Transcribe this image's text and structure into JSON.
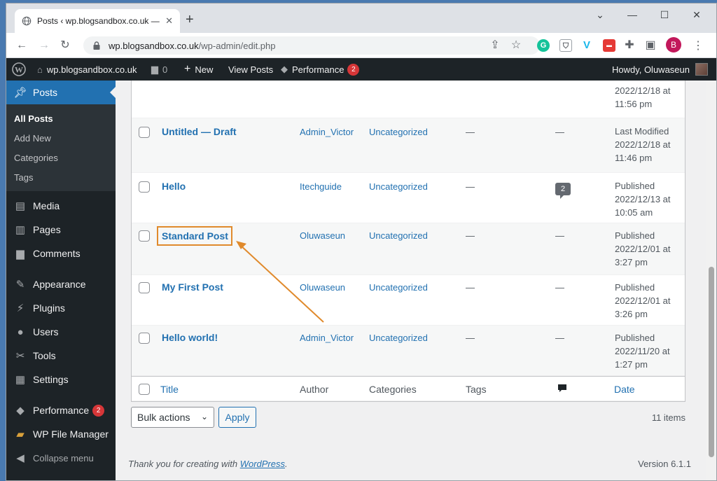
{
  "browser": {
    "tab_title": "Posts ‹ wp.blogsandbox.co.uk —",
    "tab_close": "✕",
    "new_tab": "+",
    "url_domain": "wp.blogsandbox.co.uk",
    "url_path": "/wp-admin/edit.php",
    "profile_initial": "B",
    "ext_grammarly": "G",
    "ext_vimeo": "V"
  },
  "adminbar": {
    "site_name": "wp.blogsandbox.co.uk",
    "comments_count": "0",
    "new_label": "New",
    "view_posts": "View Posts",
    "performance": "Performance",
    "performance_badge": "2",
    "howdy": "Howdy, Oluwaseun"
  },
  "sidebar": {
    "posts": "Posts",
    "sub": [
      "All Posts",
      "Add New",
      "Categories",
      "Tags"
    ],
    "media": "Media",
    "pages": "Pages",
    "comments": "Comments",
    "appearance": "Appearance",
    "plugins": "Plugins",
    "users": "Users",
    "tools": "Tools",
    "settings": "Settings",
    "performance": "Performance",
    "performance_badge": "2",
    "file_manager": "WP File Manager",
    "collapse": "Collapse menu"
  },
  "table": {
    "partial_row": {
      "date_line2": "2022/12/18 at",
      "date_line3": "11:56 pm"
    },
    "rows": [
      {
        "title": "Untitled — Draft",
        "author": "Admin_Victor",
        "category": "Uncategorized",
        "tags": "—",
        "comments": "—",
        "status": "Last Modified",
        "date": "2022/12/18 at",
        "time": "11:46 pm"
      },
      {
        "title": "Hello",
        "author": "Itechguide",
        "category": "Uncategorized",
        "tags": "—",
        "comments": "2",
        "status": "Published",
        "date": "2022/12/13 at",
        "time": "10:05 am"
      },
      {
        "title": "Standard Post",
        "author": "Oluwaseun",
        "category": "Uncategorized",
        "tags": "—",
        "comments": "—",
        "status": "Published",
        "date": "2022/12/01 at",
        "time": "3:27 pm"
      },
      {
        "title": "My First Post",
        "author": "Oluwaseun",
        "category": "Uncategorized",
        "tags": "—",
        "comments": "—",
        "status": "Published",
        "date": "2022/12/01 at",
        "time": "3:26 pm"
      },
      {
        "title": "Hello world!",
        "author": "Admin_Victor",
        "category": "Uncategorized",
        "tags": "—",
        "comments": "—",
        "status": "Published",
        "date": "2022/11/20 at",
        "time": "1:27 pm"
      }
    ],
    "footer_headers": {
      "title": "Title",
      "author": "Author",
      "categories": "Categories",
      "tags": "Tags",
      "date": "Date"
    }
  },
  "tablenav": {
    "bulk_actions": "Bulk actions",
    "apply": "Apply",
    "items_count": "11 items"
  },
  "footer": {
    "thanks_prefix": "Thank you for creating with ",
    "wordpress": "WordPress",
    "thanks_suffix": ".",
    "version": "Version 6.1.1"
  },
  "colors": {
    "accent": "#2271b1",
    "highlight": "#e08a2c",
    "admin_bg": "#1d2327"
  }
}
